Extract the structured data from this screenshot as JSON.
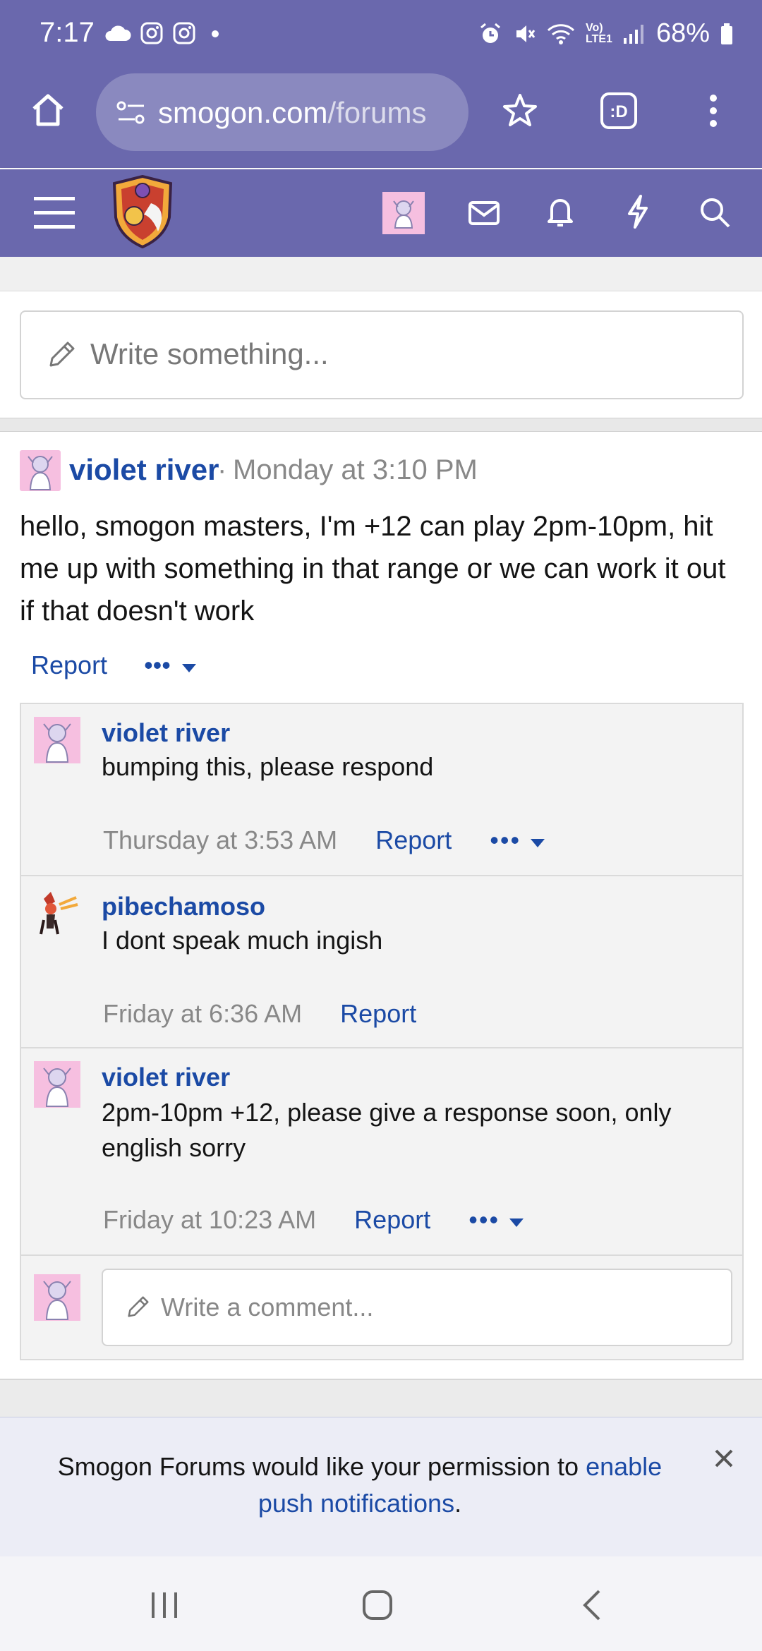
{
  "status": {
    "time": "7:17",
    "battery": "68%",
    "net_label": "Vo)\nLTE1"
  },
  "browser": {
    "url_host": "smogon.com",
    "url_path": "/forums"
  },
  "composer": {
    "placeholder": "Write something..."
  },
  "post": {
    "author": "violet river",
    "separator": "·",
    "time": "Monday at 3:10 PM",
    "body": "hello, smogon masters, I'm +12 can play 2pm-10pm, hit me up with something in that range or we can work it out if that doesn't work",
    "report_label": "Report",
    "more_label": "•••"
  },
  "comments": [
    {
      "author": "violet river",
      "text": "bumping this, please respond",
      "time": "Thursday at 3:53 AM",
      "report_label": "Report",
      "more_label": "•••"
    },
    {
      "author": "pibechamoso",
      "text": "I dont speak much ingish",
      "time": "Friday at 6:36 AM",
      "report_label": "Report"
    },
    {
      "author": "violet river",
      "text": "2pm-10pm +12, please give a response soon, only english sorry",
      "time": "Friday at 10:23 AM",
      "report_label": "Report",
      "more_label": "•••"
    }
  ],
  "comment_input": {
    "placeholder": "Write a comment..."
  },
  "notice": {
    "text_before": "Smogon Forums would like your permission to ",
    "link_text": "enable push notifications",
    "text_after": "."
  },
  "colors": {
    "header": "#6a68ad",
    "link": "#1b4aa5",
    "avatar_bg": "#f6bfe0"
  }
}
